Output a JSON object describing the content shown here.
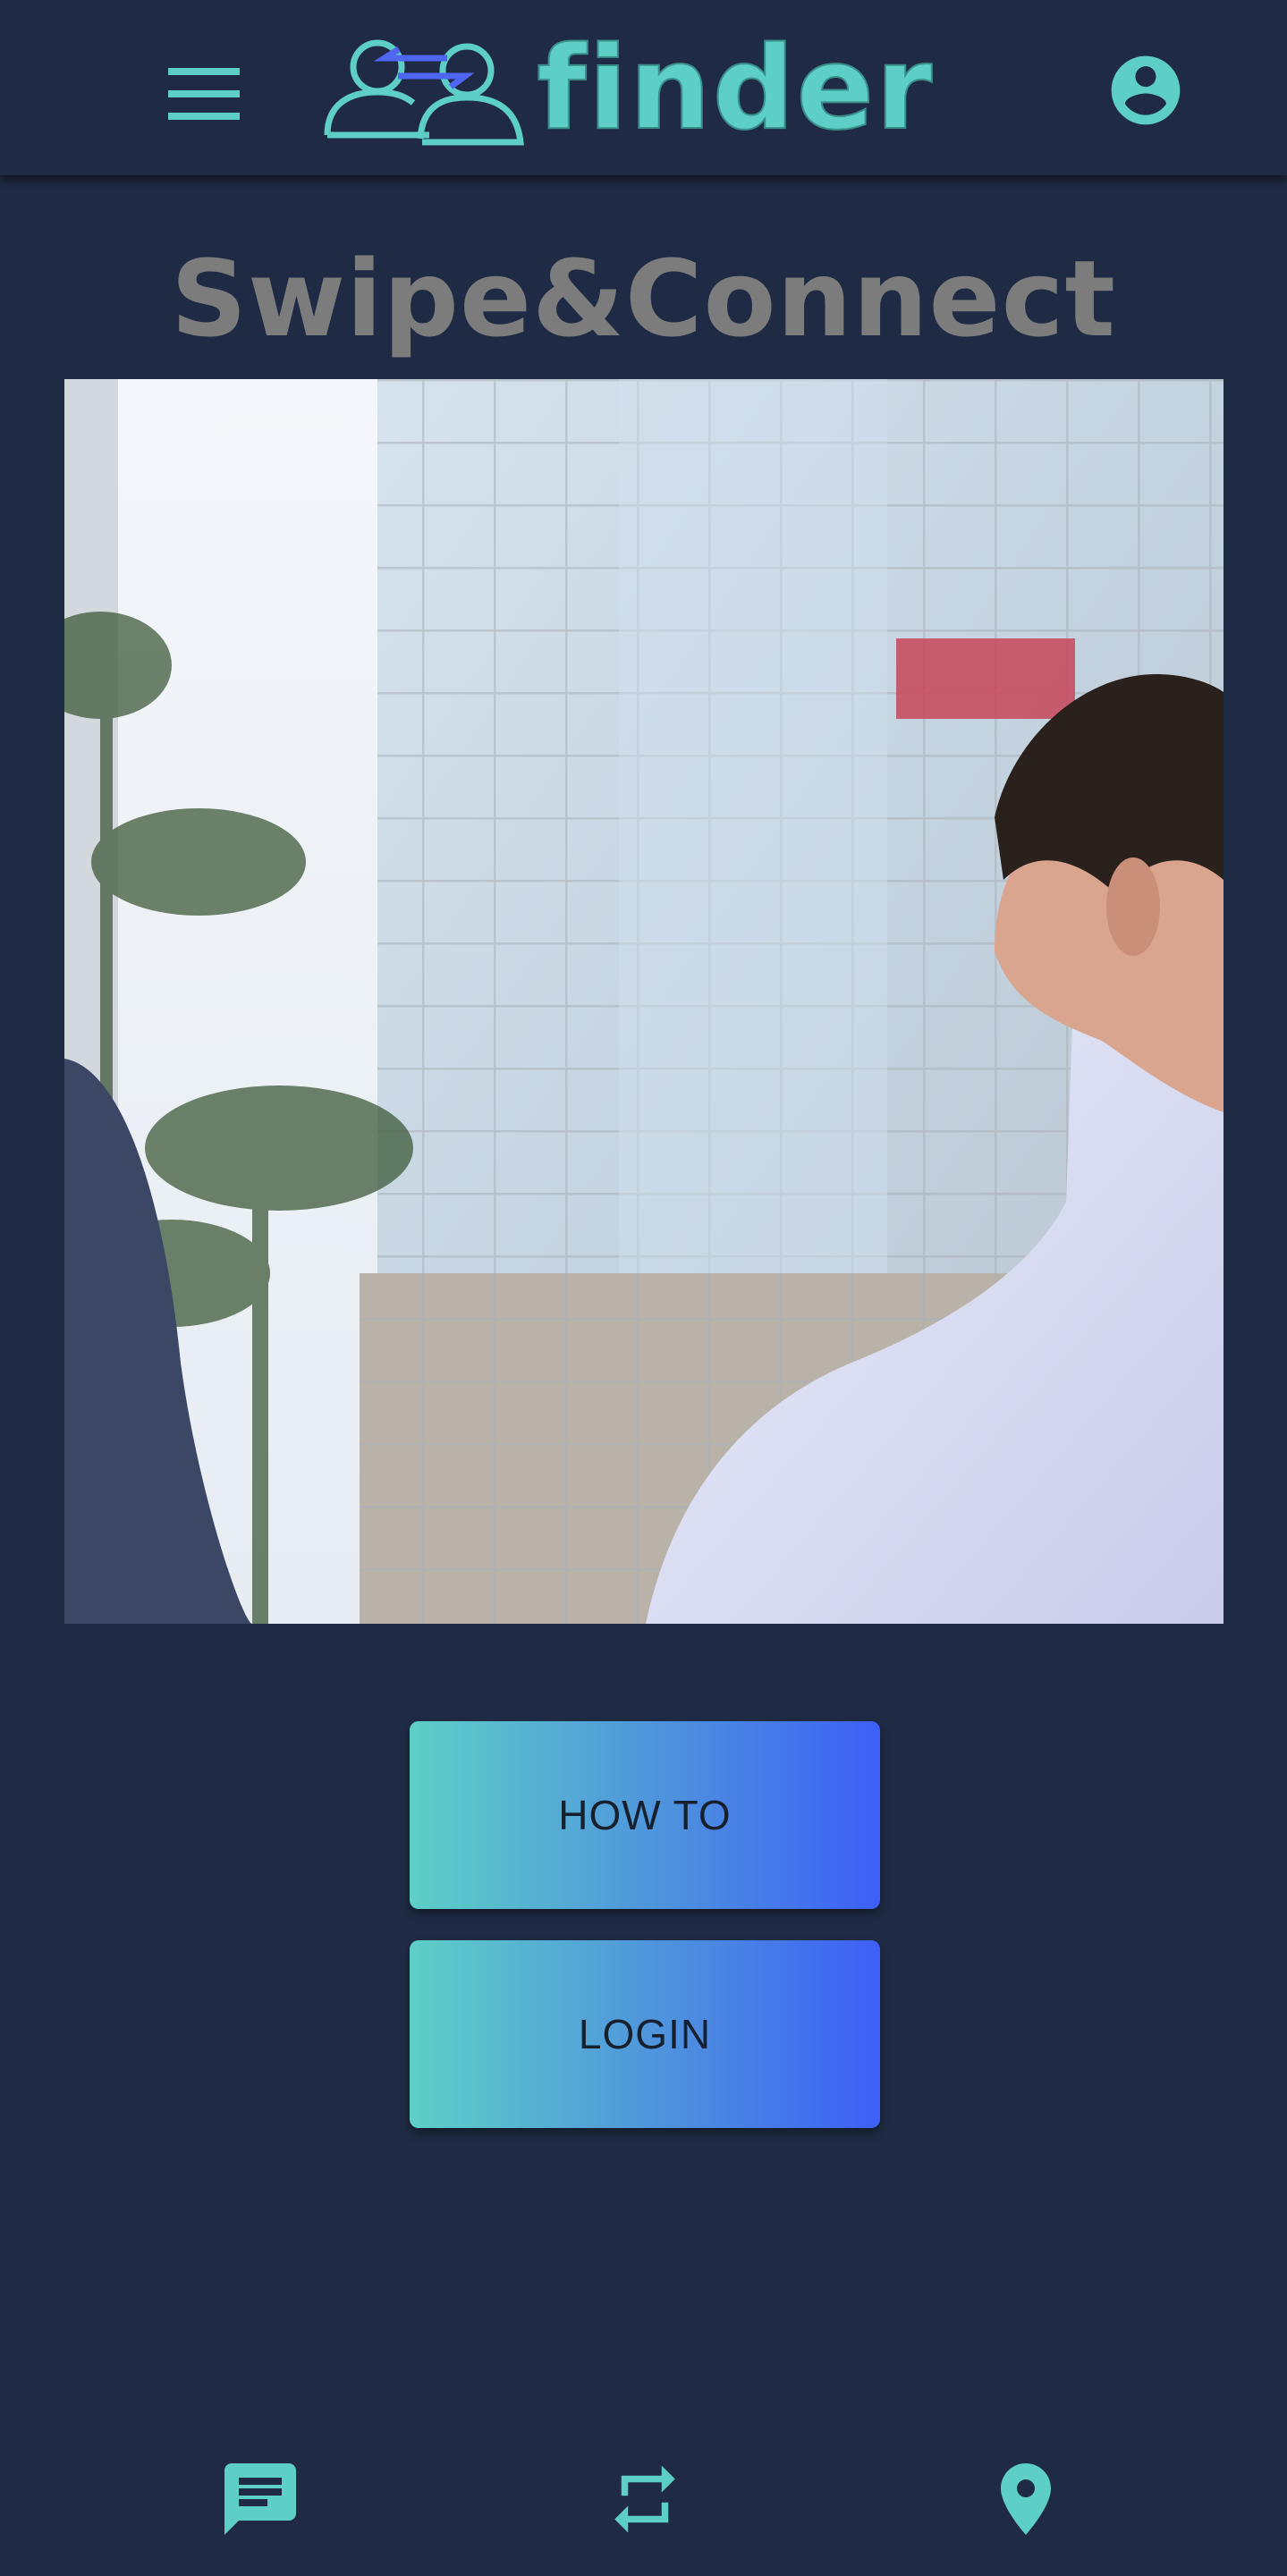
{
  "header": {
    "brand": "finder",
    "menu_icon": "menu-icon",
    "account_icon": "account-circle-icon",
    "accent_color": "#5ecfc6",
    "background_color": "#1f2b44"
  },
  "hero": {
    "title": "Swipe&Connect",
    "image_alt": "Two businessmen looking up at a glass office tower"
  },
  "actions": {
    "howto_label": "HOW TO",
    "login_label": "LOGIN",
    "gradient_start": "#5ecfc6",
    "gradient_end": "#3d5ff8"
  },
  "bottom_nav": {
    "items": [
      {
        "icon": "chat-icon"
      },
      {
        "icon": "swap-arrows-icon"
      },
      {
        "icon": "map-pin-icon"
      }
    ]
  }
}
